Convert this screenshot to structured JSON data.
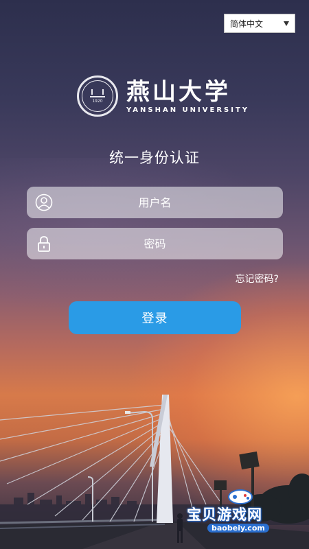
{
  "language": {
    "selected": "简体中文"
  },
  "logo": {
    "cn_name": "燕山大学",
    "en_name": "YANSHAN UNIVERSITY",
    "seal_year": "1920"
  },
  "auth": {
    "title": "统一身份认证",
    "username_placeholder": "用户名",
    "password_placeholder": "密码",
    "forgot_password": "忘记密码?",
    "login_label": "登录"
  },
  "watermark": {
    "text": "宝贝游戏网",
    "url": "baobeiy.com"
  },
  "colors": {
    "button": "#2a9be6",
    "field_bg": "rgba(245,245,248,0.55)"
  }
}
